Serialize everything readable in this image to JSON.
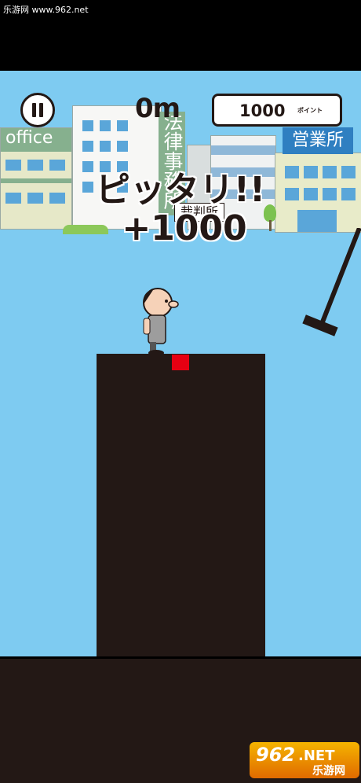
{
  "watermark": {
    "site": "乐游网 www.962.net"
  },
  "hud": {
    "distance": "0m",
    "points_value": "1000",
    "points_unit": "ポイント"
  },
  "signs": {
    "office": "office",
    "law_firm": "法律事務所",
    "court": "裁判所",
    "sales_office": "営業所"
  },
  "bonus": {
    "label": "ピッタリ!!",
    "points": "+1000"
  },
  "logo": {
    "number": "962",
    "net": ".NET",
    "name": "乐游网"
  },
  "colors": {
    "sky": "#7ecbf1",
    "ground": "#231815",
    "target": "#e60012"
  }
}
